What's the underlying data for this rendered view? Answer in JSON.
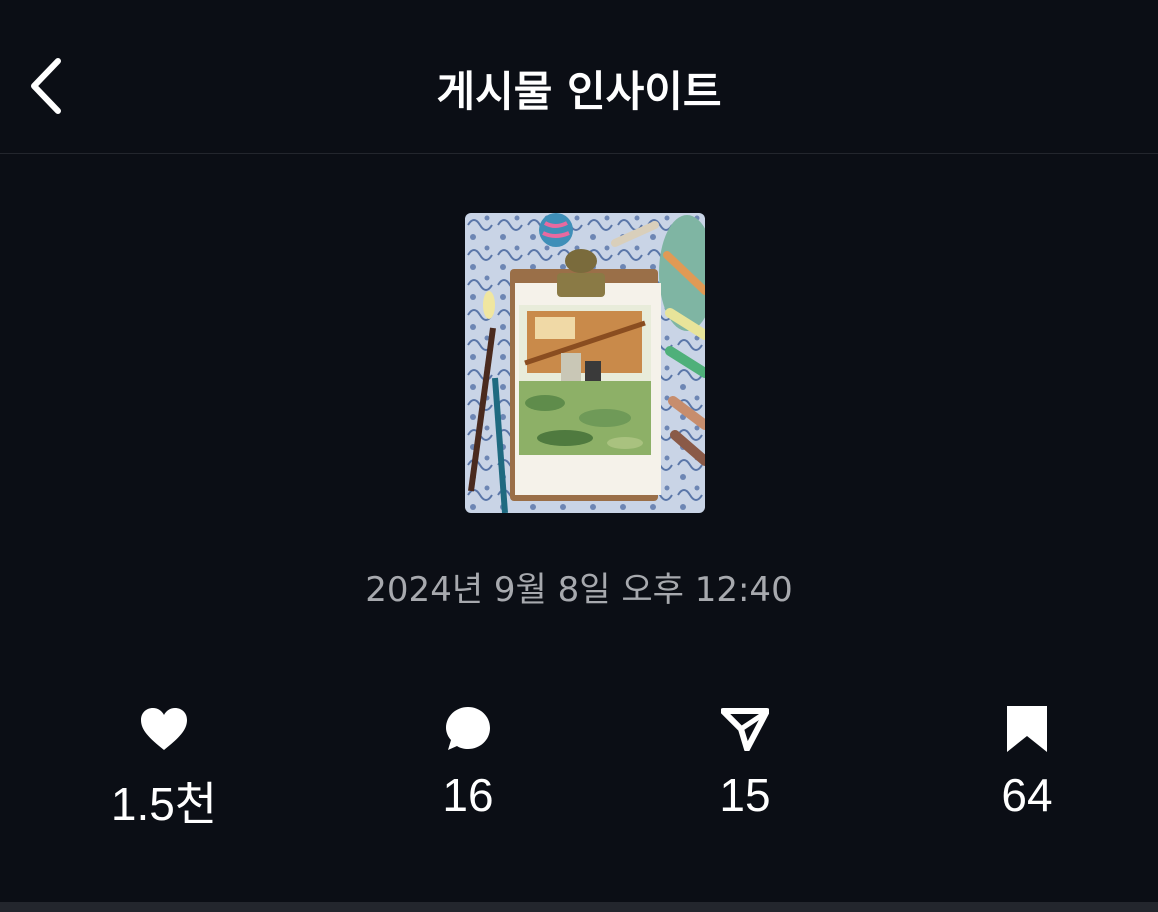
{
  "header": {
    "title": "게시물 인사이트",
    "back_icon": "chevron-left-icon"
  },
  "post": {
    "thumbnail_alt": "post thumbnail",
    "timestamp": "2024년 9월 8일 오후 12:40"
  },
  "stats": [
    {
      "name": "likes",
      "icon": "heart-icon",
      "value": "1.5천"
    },
    {
      "name": "comments",
      "icon": "comment-icon",
      "value": "16"
    },
    {
      "name": "shares",
      "icon": "send-icon",
      "value": "15"
    },
    {
      "name": "saves",
      "icon": "bookmark-icon",
      "value": "64"
    }
  ],
  "colors": {
    "background": "#0b0e15",
    "text": "#ffffff",
    "muted": "#a7a9ae",
    "divider": "#23262d"
  }
}
